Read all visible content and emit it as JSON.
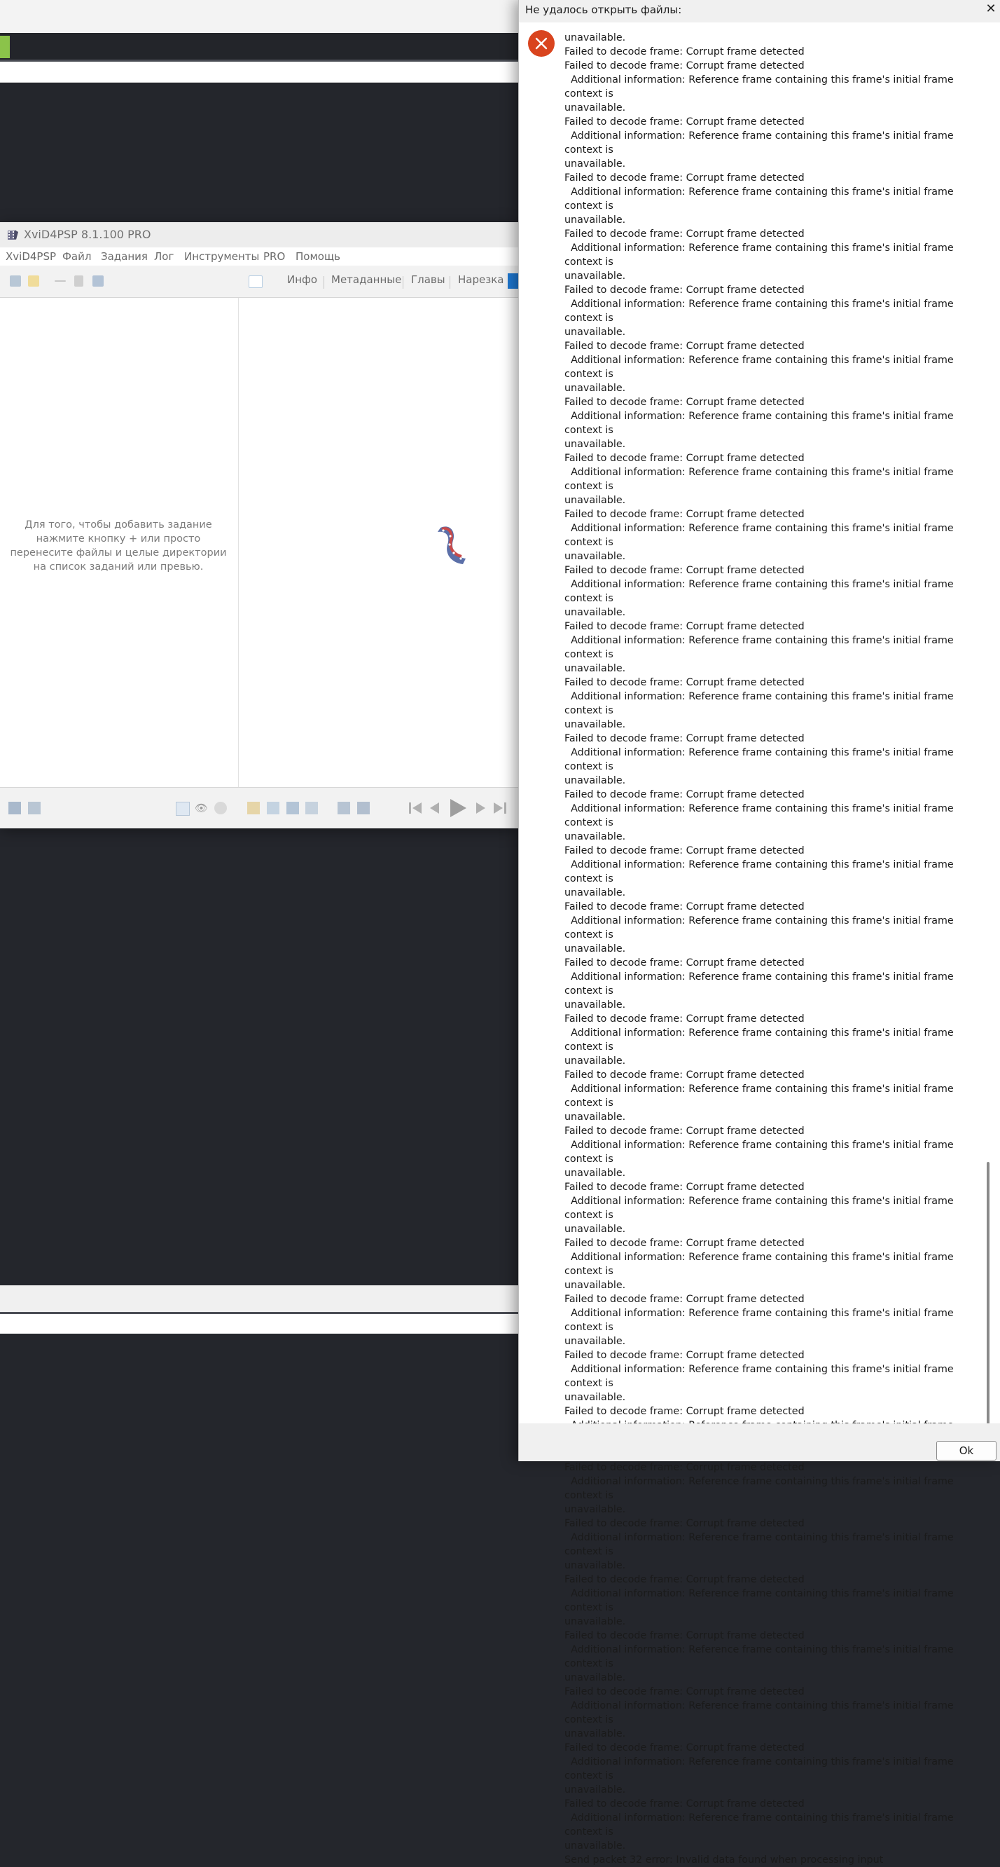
{
  "xvid_window": {
    "title": "XviD4PSP 8.1.100 PRO",
    "menu": [
      "XviD4PSP",
      "Файл",
      "Задания",
      "Лог",
      "Инструменты",
      "PRO",
      "Помощь"
    ],
    "tabs": [
      "Инфо",
      "Метаданные",
      "Главы",
      "Нарезка"
    ],
    "task_hint": "Для того, чтобы добавить задание нажмите кнопку + или просто перенесите файлы и целые директории на список заданий или превью.",
    "icons": {
      "title": "film-app-icon",
      "toolbar": [
        "open-file-icon",
        "folder-icon",
        "remove-icon",
        "delete-icon",
        "save-icon",
        "preview-icon"
      ],
      "preview": "film-reel-icon",
      "bottom": [
        "add-task-icon",
        "filter-icon",
        "window-icon",
        "eye-icon",
        "settings-icon",
        "picture-icon",
        "crop-icon",
        "resize-icon",
        "frame-icon",
        "audio-icon",
        "video-icon",
        "first-frame-icon",
        "prev-frame-icon",
        "play-icon",
        "next-frame-icon",
        "last-frame-icon"
      ]
    }
  },
  "dialog": {
    "title": "Не удалось открыть файлы:",
    "first_line": "unavailable.",
    "lone_line": "Failed to decode frame: Corrupt frame detected",
    "repeat_count": 32,
    "repeat_block": [
      "Failed to decode frame: Corrupt frame detected",
      "  Additional information: Reference frame containing this frame's initial frame context is",
      "unavailable."
    ],
    "last_line": "Send packet 32 error: Invalid data found when processing input",
    "ok_label": "Ok",
    "icons": {
      "close": "close-icon",
      "error": "error-icon"
    }
  },
  "colors": {
    "desktop": "#24262c",
    "accent_green": "#8bc34a",
    "active_tab": "#1e78d2",
    "error_red": "#d9441e"
  }
}
